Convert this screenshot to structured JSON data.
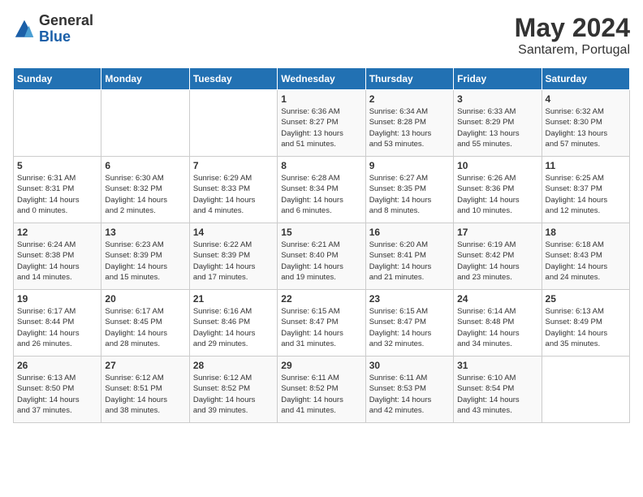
{
  "logo": {
    "general": "General",
    "blue": "Blue"
  },
  "title": "May 2024",
  "location": "Santarem, Portugal",
  "days_header": [
    "Sunday",
    "Monday",
    "Tuesday",
    "Wednesday",
    "Thursday",
    "Friday",
    "Saturday"
  ],
  "weeks": [
    [
      {
        "day": "",
        "info": ""
      },
      {
        "day": "",
        "info": ""
      },
      {
        "day": "",
        "info": ""
      },
      {
        "day": "1",
        "info": "Sunrise: 6:36 AM\nSunset: 8:27 PM\nDaylight: 13 hours\nand 51 minutes."
      },
      {
        "day": "2",
        "info": "Sunrise: 6:34 AM\nSunset: 8:28 PM\nDaylight: 13 hours\nand 53 minutes."
      },
      {
        "day": "3",
        "info": "Sunrise: 6:33 AM\nSunset: 8:29 PM\nDaylight: 13 hours\nand 55 minutes."
      },
      {
        "day": "4",
        "info": "Sunrise: 6:32 AM\nSunset: 8:30 PM\nDaylight: 13 hours\nand 57 minutes."
      }
    ],
    [
      {
        "day": "5",
        "info": "Sunrise: 6:31 AM\nSunset: 8:31 PM\nDaylight: 14 hours\nand 0 minutes."
      },
      {
        "day": "6",
        "info": "Sunrise: 6:30 AM\nSunset: 8:32 PM\nDaylight: 14 hours\nand 2 minutes."
      },
      {
        "day": "7",
        "info": "Sunrise: 6:29 AM\nSunset: 8:33 PM\nDaylight: 14 hours\nand 4 minutes."
      },
      {
        "day": "8",
        "info": "Sunrise: 6:28 AM\nSunset: 8:34 PM\nDaylight: 14 hours\nand 6 minutes."
      },
      {
        "day": "9",
        "info": "Sunrise: 6:27 AM\nSunset: 8:35 PM\nDaylight: 14 hours\nand 8 minutes."
      },
      {
        "day": "10",
        "info": "Sunrise: 6:26 AM\nSunset: 8:36 PM\nDaylight: 14 hours\nand 10 minutes."
      },
      {
        "day": "11",
        "info": "Sunrise: 6:25 AM\nSunset: 8:37 PM\nDaylight: 14 hours\nand 12 minutes."
      }
    ],
    [
      {
        "day": "12",
        "info": "Sunrise: 6:24 AM\nSunset: 8:38 PM\nDaylight: 14 hours\nand 14 minutes."
      },
      {
        "day": "13",
        "info": "Sunrise: 6:23 AM\nSunset: 8:39 PM\nDaylight: 14 hours\nand 15 minutes."
      },
      {
        "day": "14",
        "info": "Sunrise: 6:22 AM\nSunset: 8:39 PM\nDaylight: 14 hours\nand 17 minutes."
      },
      {
        "day": "15",
        "info": "Sunrise: 6:21 AM\nSunset: 8:40 PM\nDaylight: 14 hours\nand 19 minutes."
      },
      {
        "day": "16",
        "info": "Sunrise: 6:20 AM\nSunset: 8:41 PM\nDaylight: 14 hours\nand 21 minutes."
      },
      {
        "day": "17",
        "info": "Sunrise: 6:19 AM\nSunset: 8:42 PM\nDaylight: 14 hours\nand 23 minutes."
      },
      {
        "day": "18",
        "info": "Sunrise: 6:18 AM\nSunset: 8:43 PM\nDaylight: 14 hours\nand 24 minutes."
      }
    ],
    [
      {
        "day": "19",
        "info": "Sunrise: 6:17 AM\nSunset: 8:44 PM\nDaylight: 14 hours\nand 26 minutes."
      },
      {
        "day": "20",
        "info": "Sunrise: 6:17 AM\nSunset: 8:45 PM\nDaylight: 14 hours\nand 28 minutes."
      },
      {
        "day": "21",
        "info": "Sunrise: 6:16 AM\nSunset: 8:46 PM\nDaylight: 14 hours\nand 29 minutes."
      },
      {
        "day": "22",
        "info": "Sunrise: 6:15 AM\nSunset: 8:47 PM\nDaylight: 14 hours\nand 31 minutes."
      },
      {
        "day": "23",
        "info": "Sunrise: 6:15 AM\nSunset: 8:47 PM\nDaylight: 14 hours\nand 32 minutes."
      },
      {
        "day": "24",
        "info": "Sunrise: 6:14 AM\nSunset: 8:48 PM\nDaylight: 14 hours\nand 34 minutes."
      },
      {
        "day": "25",
        "info": "Sunrise: 6:13 AM\nSunset: 8:49 PM\nDaylight: 14 hours\nand 35 minutes."
      }
    ],
    [
      {
        "day": "26",
        "info": "Sunrise: 6:13 AM\nSunset: 8:50 PM\nDaylight: 14 hours\nand 37 minutes."
      },
      {
        "day": "27",
        "info": "Sunrise: 6:12 AM\nSunset: 8:51 PM\nDaylight: 14 hours\nand 38 minutes."
      },
      {
        "day": "28",
        "info": "Sunrise: 6:12 AM\nSunset: 8:52 PM\nDaylight: 14 hours\nand 39 minutes."
      },
      {
        "day": "29",
        "info": "Sunrise: 6:11 AM\nSunset: 8:52 PM\nDaylight: 14 hours\nand 41 minutes."
      },
      {
        "day": "30",
        "info": "Sunrise: 6:11 AM\nSunset: 8:53 PM\nDaylight: 14 hours\nand 42 minutes."
      },
      {
        "day": "31",
        "info": "Sunrise: 6:10 AM\nSunset: 8:54 PM\nDaylight: 14 hours\nand 43 minutes."
      },
      {
        "day": "",
        "info": ""
      }
    ]
  ]
}
